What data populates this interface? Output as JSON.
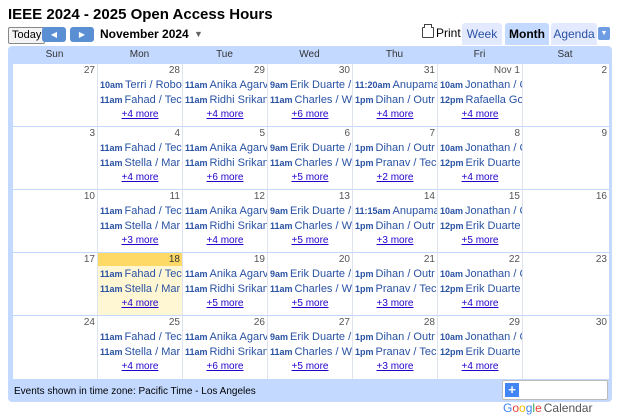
{
  "title": "IEEE 2024 - 2025 Open Access Hours",
  "toolbar": {
    "today_label": "Today",
    "prev_icon": "◀",
    "next_icon": "▶",
    "month_label": "November 2024",
    "dropdown_icon": "▼",
    "print_label": "Print",
    "tabs": [
      "Week",
      "Month",
      "Agenda"
    ],
    "active_tab": "Month"
  },
  "weekdays": [
    "Sun",
    "Mon",
    "Tue",
    "Wed",
    "Thu",
    "Fri",
    "Sat"
  ],
  "colors": {
    "accent": "#c3d9ff",
    "event_text": "#2952a3",
    "today_bg": "#fff7d4"
  },
  "weeks": [
    {
      "days": [
        {
          "num": "27",
          "events": [],
          "more": ""
        },
        {
          "num": "28",
          "events": [
            {
              "time": "10am",
              "text": "Terri / Robo"
            },
            {
              "time": "11am",
              "text": "Fahad / Tec"
            }
          ],
          "more": "+4 more"
        },
        {
          "num": "29",
          "events": [
            {
              "time": "11am",
              "text": "Anika Agarv"
            },
            {
              "time": "11am",
              "text": "Ridhi Srikan"
            }
          ],
          "more": "+4 more"
        },
        {
          "num": "30",
          "events": [
            {
              "time": "9am",
              "text": "Erik Duarte /"
            },
            {
              "time": "11am",
              "text": "Charles / W"
            }
          ],
          "more": "+6 more"
        },
        {
          "num": "31",
          "events": [
            {
              "time": "11:20am",
              "text": "Anupama"
            },
            {
              "time": "1pm",
              "text": "Dihan / Outr"
            }
          ],
          "more": "+4 more"
        },
        {
          "num": "Nov 1",
          "events": [
            {
              "time": "10am",
              "text": "Jonathan / C"
            },
            {
              "time": "12pm",
              "text": "Rafaella Go"
            }
          ],
          "more": "+4 more"
        },
        {
          "num": "2",
          "events": [],
          "more": ""
        }
      ]
    },
    {
      "days": [
        {
          "num": "3",
          "events": [],
          "more": ""
        },
        {
          "num": "4",
          "events": [
            {
              "time": "11am",
              "text": "Fahad / Tec"
            },
            {
              "time": "11am",
              "text": "Stella / Mar"
            }
          ],
          "more": "+4 more"
        },
        {
          "num": "5",
          "events": [
            {
              "time": "11am",
              "text": "Anika Agarv"
            },
            {
              "time": "11am",
              "text": "Ridhi Srikan"
            }
          ],
          "more": "+6 more"
        },
        {
          "num": "6",
          "events": [
            {
              "time": "9am",
              "text": "Erik Duarte /"
            },
            {
              "time": "11am",
              "text": "Charles / W"
            }
          ],
          "more": "+5 more"
        },
        {
          "num": "7",
          "events": [
            {
              "time": "1pm",
              "text": "Dihan / Outr"
            },
            {
              "time": "1pm",
              "text": "Pranav / Tec"
            }
          ],
          "more": "+2 more"
        },
        {
          "num": "8",
          "events": [
            {
              "time": "10am",
              "text": "Jonathan / C"
            },
            {
              "time": "12pm",
              "text": "Erik Duarte"
            }
          ],
          "more": "+4 more"
        },
        {
          "num": "9",
          "events": [],
          "more": ""
        }
      ]
    },
    {
      "days": [
        {
          "num": "10",
          "events": [],
          "more": ""
        },
        {
          "num": "11",
          "events": [
            {
              "time": "11am",
              "text": "Fahad / Tec"
            },
            {
              "time": "11am",
              "text": "Stella / Mar"
            }
          ],
          "more": "+3 more"
        },
        {
          "num": "12",
          "events": [
            {
              "time": "11am",
              "text": "Anika Agarv"
            },
            {
              "time": "11am",
              "text": "Ridhi Srikan"
            }
          ],
          "more": "+4 more"
        },
        {
          "num": "13",
          "events": [
            {
              "time": "9am",
              "text": "Erik Duarte /"
            },
            {
              "time": "11am",
              "text": "Charles / W"
            }
          ],
          "more": "+5 more"
        },
        {
          "num": "14",
          "events": [
            {
              "time": "11:15am",
              "text": "Anupama"
            },
            {
              "time": "1pm",
              "text": "Dihan / Outr"
            }
          ],
          "more": "+3 more"
        },
        {
          "num": "15",
          "events": [
            {
              "time": "10am",
              "text": "Jonathan / C"
            },
            {
              "time": "12pm",
              "text": "Erik Duarte"
            }
          ],
          "more": "+5 more"
        },
        {
          "num": "16",
          "events": [],
          "more": ""
        }
      ]
    },
    {
      "days": [
        {
          "num": "17",
          "events": [],
          "more": ""
        },
        {
          "num": "18",
          "today": true,
          "events": [
            {
              "time": "11am",
              "text": "Fahad / Tec"
            },
            {
              "time": "11am",
              "text": "Stella / Mar"
            }
          ],
          "more": "+4 more"
        },
        {
          "num": "19",
          "events": [
            {
              "time": "11am",
              "text": "Anika Agarv"
            },
            {
              "time": "11am",
              "text": "Ridhi Srikan"
            }
          ],
          "more": "+5 more"
        },
        {
          "num": "20",
          "events": [
            {
              "time": "9am",
              "text": "Erik Duarte /"
            },
            {
              "time": "11am",
              "text": "Charles / W"
            }
          ],
          "more": "+5 more"
        },
        {
          "num": "21",
          "events": [
            {
              "time": "1pm",
              "text": "Dihan / Outr"
            },
            {
              "time": "1pm",
              "text": "Pranav / Tec"
            }
          ],
          "more": "+3 more"
        },
        {
          "num": "22",
          "events": [
            {
              "time": "10am",
              "text": "Jonathan / C"
            },
            {
              "time": "12pm",
              "text": "Erik Duarte"
            }
          ],
          "more": "+4 more"
        },
        {
          "num": "23",
          "events": [],
          "more": ""
        }
      ]
    },
    {
      "days": [
        {
          "num": "24",
          "events": [],
          "more": ""
        },
        {
          "num": "25",
          "events": [
            {
              "time": "11am",
              "text": "Fahad / Tec"
            },
            {
              "time": "11am",
              "text": "Stella / Mar"
            }
          ],
          "more": "+4 more"
        },
        {
          "num": "26",
          "events": [
            {
              "time": "11am",
              "text": "Anika Agarv"
            },
            {
              "time": "11am",
              "text": "Ridhi Srikan"
            }
          ],
          "more": "+6 more"
        },
        {
          "num": "27",
          "events": [
            {
              "time": "9am",
              "text": "Erik Duarte /"
            },
            {
              "time": "11am",
              "text": "Charles / W"
            }
          ],
          "more": "+5 more"
        },
        {
          "num": "28",
          "events": [
            {
              "time": "1pm",
              "text": "Dihan / Outr"
            },
            {
              "time": "1pm",
              "text": "Pranav / Tec"
            }
          ],
          "more": "+3 more"
        },
        {
          "num": "29",
          "events": [
            {
              "time": "10am",
              "text": "Jonathan / C"
            },
            {
              "time": "12pm",
              "text": "Erik Duarte"
            }
          ],
          "more": "+4 more"
        },
        {
          "num": "30",
          "events": [],
          "more": ""
        }
      ]
    }
  ],
  "footer": {
    "timezone_text": "Events shown in time zone: Pacific Time - Los Angeles",
    "badge_plus": "+",
    "badge_google": "Google",
    "badge_calendar": "Calendar"
  }
}
